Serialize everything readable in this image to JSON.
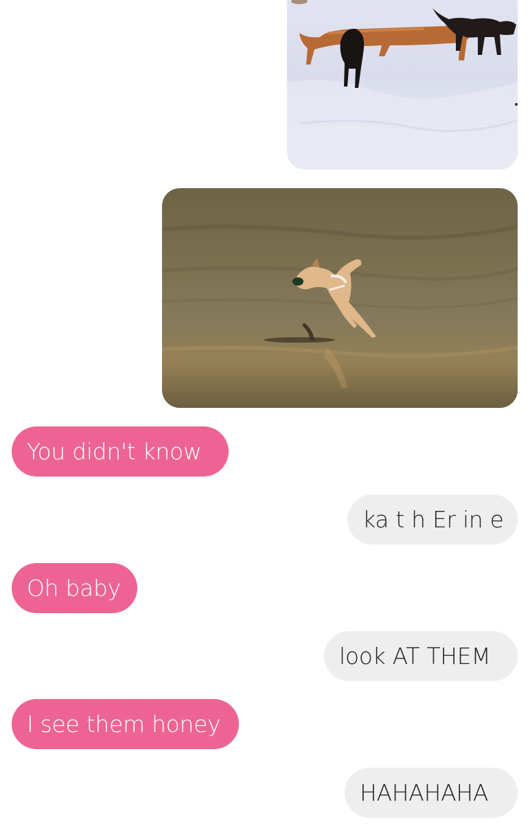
{
  "conversation": {
    "attachments": [
      {
        "subject": "dogs in snow"
      },
      {
        "subject": "dog leaping on beach"
      }
    ],
    "messages": [
      {
        "direction": "incoming",
        "text": "You didn't know"
      },
      {
        "direction": "outgoing",
        "text": "ka t h Er in e"
      },
      {
        "direction": "incoming",
        "text": "Oh baby"
      },
      {
        "direction": "outgoing",
        "text": "look AT THEM"
      },
      {
        "direction": "incoming",
        "text": "I see them honey"
      },
      {
        "direction": "outgoing",
        "text": "HAHAHAHA"
      }
    ]
  },
  "colors": {
    "incoming_bubble": "#ed6494",
    "outgoing_bubble": "#eeeeee",
    "background": "#ffffff"
  }
}
